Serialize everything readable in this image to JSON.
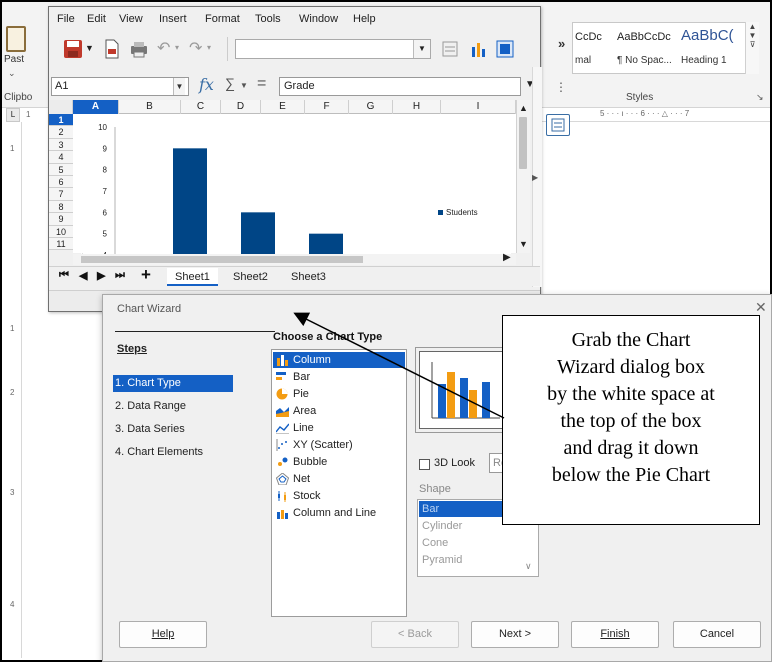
{
  "word": {
    "paste_label": "Past",
    "clipboard_label": "Clipbo",
    "styles": [
      {
        "sample": "CcDc",
        "name": "mal"
      },
      {
        "sample": "AaBbCcDc",
        "name": "¶ No Spac..."
      },
      {
        "sample": "AaBbC(",
        "name": "Heading 1"
      }
    ],
    "styles_group_label": "Styles",
    "ruler_text": "5 · · · ı · · · 6 · · · △ · · · 7",
    "ruler_corner": "L",
    "left_ruler_numbers": [
      "1",
      "1",
      "2",
      "3",
      "4"
    ],
    "ruler_top_num": "1"
  },
  "calc": {
    "menu": [
      "File",
      "Edit",
      "View",
      "Insert",
      "Format",
      "Tools",
      "Window",
      "Help"
    ],
    "name_box": "A1",
    "formula": "Grade",
    "columns": [
      "A",
      "B",
      "C",
      "D",
      "E",
      "F",
      "G",
      "H",
      "I"
    ],
    "rows": [
      "1",
      "2",
      "3",
      "4",
      "5",
      "6",
      "7",
      "8",
      "9",
      "10",
      "11"
    ],
    "sheets": [
      "Sheet1",
      "Sheet2",
      "Sheet3"
    ],
    "active_sheet": "Sheet1",
    "nav": [
      "⏮",
      "◀",
      "▶",
      "⏭",
      "+"
    ]
  },
  "chart_data": {
    "type": "bar",
    "categories": [
      "",
      "",
      ""
    ],
    "series": [
      {
        "name": "Students",
        "values": [
          9,
          6,
          5
        ],
        "color": "#004586"
      }
    ],
    "y_ticks": [
      "4",
      "5",
      "6",
      "7",
      "8",
      "9",
      "10"
    ],
    "ylim": [
      4,
      10
    ],
    "legend": "Students",
    "legend_position": "right",
    "grid": false
  },
  "wizard": {
    "title": "Chart Wizard",
    "steps_title": "Steps",
    "steps": [
      "1. Chart Type",
      "2. Data Range",
      "3. Data Series",
      "4. Chart Elements"
    ],
    "active_step": 0,
    "chooser_title": "Choose a Chart Type",
    "chart_types": [
      {
        "label": "Column",
        "icon": "column-chart-icon"
      },
      {
        "label": "Bar",
        "icon": "bar-chart-icon"
      },
      {
        "label": "Pie",
        "icon": "pie-chart-icon"
      },
      {
        "label": "Area",
        "icon": "area-chart-icon"
      },
      {
        "label": "Line",
        "icon": "line-chart-icon"
      },
      {
        "label": "XY (Scatter)",
        "icon": "scatter-chart-icon"
      },
      {
        "label": "Bubble",
        "icon": "bubble-chart-icon"
      },
      {
        "label": "Net",
        "icon": "net-chart-icon"
      },
      {
        "label": "Stock",
        "icon": "stock-chart-icon"
      },
      {
        "label": "Column and Line",
        "icon": "column-line-chart-icon"
      }
    ],
    "selected_type": 0,
    "look_label": "3D Look",
    "look_value": "Re",
    "shape_label": "Shape",
    "shapes": [
      "Bar",
      "Cylinder",
      "Cone",
      "Pyramid"
    ],
    "buttons": {
      "help": "Help",
      "back": "< Back",
      "next": "Next >",
      "finish": "Finish",
      "cancel": "Cancel"
    }
  },
  "callout": {
    "lines": [
      "Grab the Chart",
      "Wizard dialog box",
      "by the white space at",
      "the top of the box",
      "and drag it down",
      "below the Pie Chart"
    ]
  }
}
